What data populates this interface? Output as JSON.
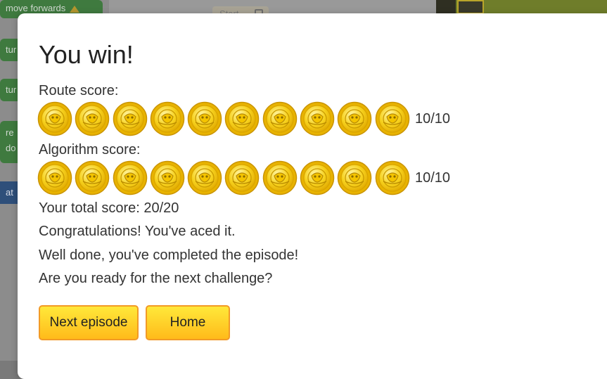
{
  "background": {
    "blocks": {
      "move_forwards": "move forwards",
      "turn_1": "tur",
      "turn_2": "tur",
      "repeat": "re",
      "repeat_do": "do",
      "at": "at"
    },
    "start_button": "Start"
  },
  "modal": {
    "title": "You win!",
    "route_label": "Route score:",
    "route_coins": 10,
    "route_score": "10/10",
    "algorithm_label": "Algorithm score:",
    "algorithm_coins": 10,
    "algorithm_score": "10/10",
    "total": "Your total score: 20/20",
    "messages": [
      "Congratulations! You've aced it.",
      "Well done, you've completed the episode!",
      "Are you ready for the next challenge?"
    ],
    "buttons": {
      "next": "Next episode",
      "home": "Home"
    }
  },
  "colors": {
    "coin_gold": "#f5c518",
    "coin_rim": "#d9a400",
    "button_border": "#f29a26"
  },
  "icons": {
    "coin": "gold-coin-icon"
  }
}
